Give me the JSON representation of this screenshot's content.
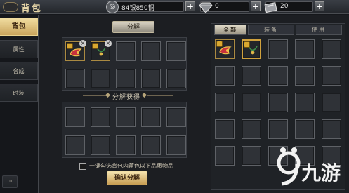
{
  "window": {
    "title": "背包"
  },
  "currency": {
    "silver": {
      "value": "84银850铜",
      "icon": "coin-icon"
    },
    "diamond": {
      "value": "0",
      "icon": "diamond-icon"
    },
    "ticket": {
      "value": "20",
      "icon": "ticket-icon"
    }
  },
  "sidebar": {
    "items": [
      {
        "label": "背包",
        "active": true
      },
      {
        "label": "属性",
        "active": false
      },
      {
        "label": "合成",
        "active": false
      },
      {
        "label": "时装",
        "active": false
      }
    ]
  },
  "decompose": {
    "header": "分解",
    "result_label": "分解获得",
    "auto_select_label": "一键勾选背包内蓝色以下品质物品",
    "confirm_button": "确认分解",
    "input_slots": [
      {
        "filled": true,
        "locked": true,
        "removable": true,
        "item": "crimson-horn-icon"
      },
      {
        "filled": true,
        "locked": true,
        "removable": true,
        "item": "green-necklace-icon"
      },
      {
        "filled": false
      },
      {
        "filled": false
      },
      {
        "filled": false
      },
      {
        "filled": false
      },
      {
        "filled": false
      },
      {
        "filled": false
      },
      {
        "filled": false
      },
      {
        "filled": false
      }
    ]
  },
  "inventory": {
    "tabs": [
      {
        "label": "全部",
        "active": true
      },
      {
        "label": "装备",
        "active": false
      },
      {
        "label": "使用",
        "active": false
      }
    ],
    "slots": [
      {
        "filled": true,
        "locked": true,
        "item": "crimson-horn-icon"
      },
      {
        "filled": true,
        "locked": true,
        "selected": true,
        "item": "green-necklace-icon"
      }
    ]
  },
  "watermark": {
    "text": "九游"
  },
  "colors": {
    "gold": "#d1a23d",
    "accent": "#e9d28e"
  }
}
